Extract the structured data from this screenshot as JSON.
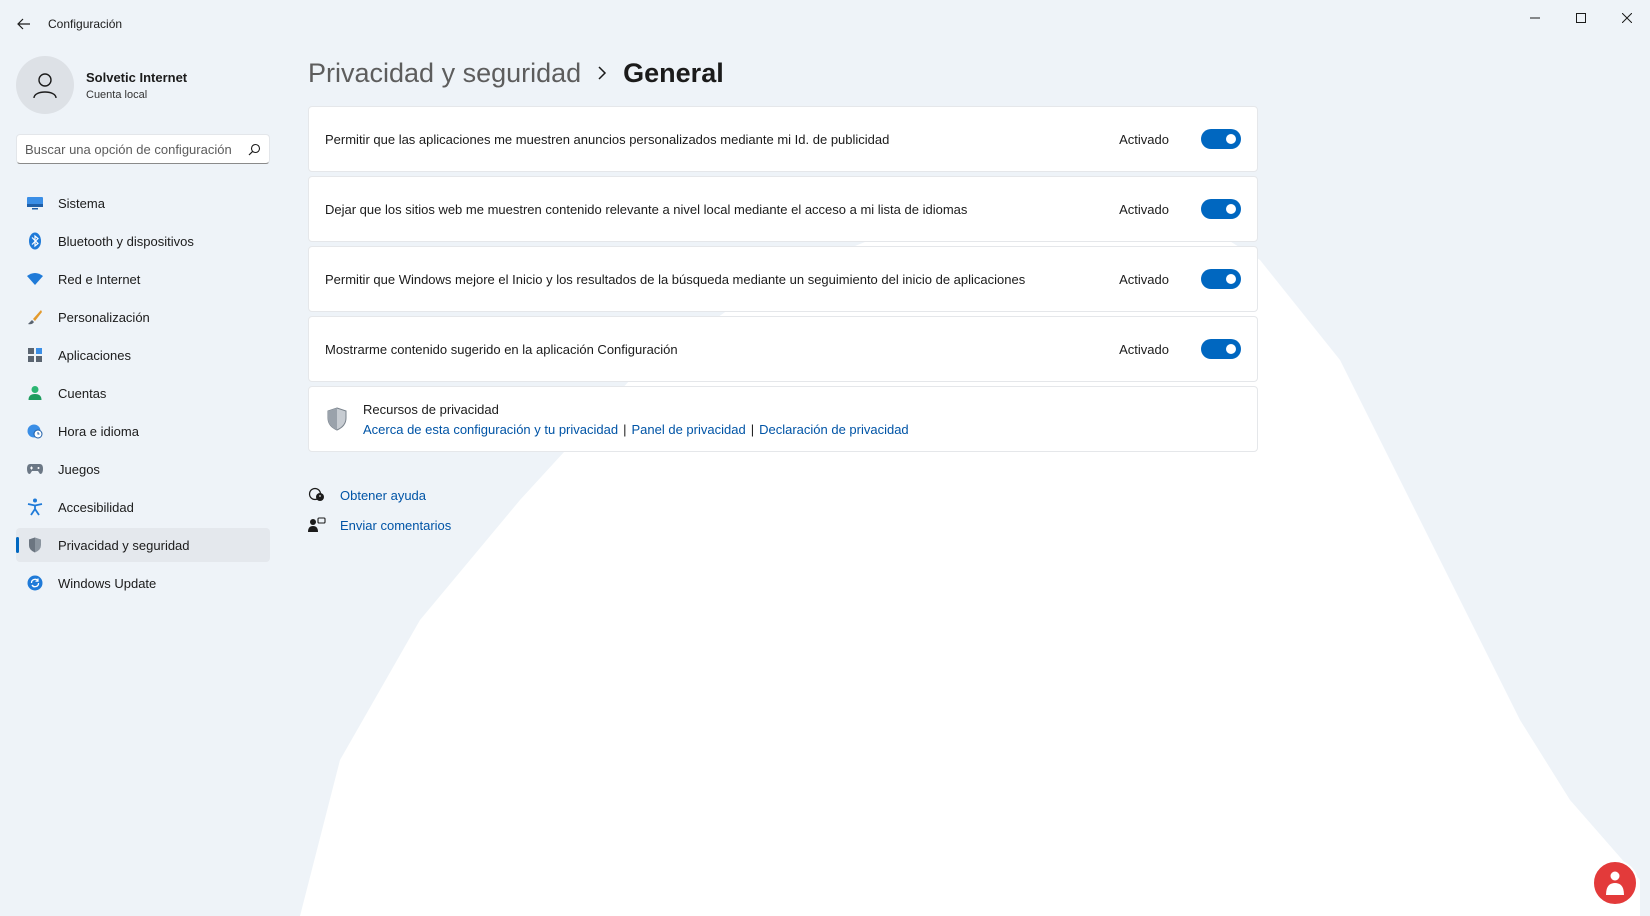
{
  "window": {
    "title": "Configuración",
    "controls": [
      "minimize-icon",
      "maximize-icon",
      "close-icon"
    ]
  },
  "profile": {
    "name": "Solvetic Internet",
    "account_type": "Cuenta local"
  },
  "search": {
    "placeholder": "Buscar una opción de configuración"
  },
  "sidebar": {
    "items": [
      {
        "label": "Sistema",
        "icon": "monitor-icon",
        "active": false
      },
      {
        "label": "Bluetooth y dispositivos",
        "icon": "bluetooth-icon",
        "active": false
      },
      {
        "label": "Red e Internet",
        "icon": "wifi-icon",
        "active": false
      },
      {
        "label": "Personalización",
        "icon": "brush-icon",
        "active": false
      },
      {
        "label": "Aplicaciones",
        "icon": "apps-icon",
        "active": false
      },
      {
        "label": "Cuentas",
        "icon": "person-icon",
        "active": false
      },
      {
        "label": "Hora e idioma",
        "icon": "globe-clock-icon",
        "active": false
      },
      {
        "label": "Juegos",
        "icon": "gamepad-icon",
        "active": false
      },
      {
        "label": "Accesibilidad",
        "icon": "accessibility-icon",
        "active": false
      },
      {
        "label": "Privacidad y seguridad",
        "icon": "shield-icon",
        "active": true
      },
      {
        "label": "Windows Update",
        "icon": "update-icon",
        "active": false
      }
    ]
  },
  "breadcrumb": {
    "parent": "Privacidad y seguridad",
    "current": "General"
  },
  "settings": [
    {
      "label": "Permitir que las aplicaciones me muestren anuncios personalizados mediante mi Id. de publicidad",
      "state": "Activado",
      "on": true
    },
    {
      "label": "Dejar que los sitios web me muestren contenido relevante a nivel local mediante el acceso a mi lista de idiomas",
      "state": "Activado",
      "on": true
    },
    {
      "label": "Permitir que Windows mejore el Inicio y los resultados de la búsqueda mediante un seguimiento del inicio de aplicaciones",
      "state": "Activado",
      "on": true
    },
    {
      "label": "Mostrarme contenido sugerido en la aplicación Configuración",
      "state": "Activado",
      "on": true
    }
  ],
  "resources": {
    "title": "Recursos de privacidad",
    "links": [
      "Acerca de esta configuración y tu privacidad",
      "Panel de privacidad",
      "Declaración de privacidad"
    ],
    "separator": "|"
  },
  "help": {
    "get_help": "Obtener ayuda",
    "feedback": "Enviar comentarios"
  },
  "colors": {
    "accent": "#0067c0",
    "link": "#0054a6",
    "background": "#eef3f8"
  }
}
